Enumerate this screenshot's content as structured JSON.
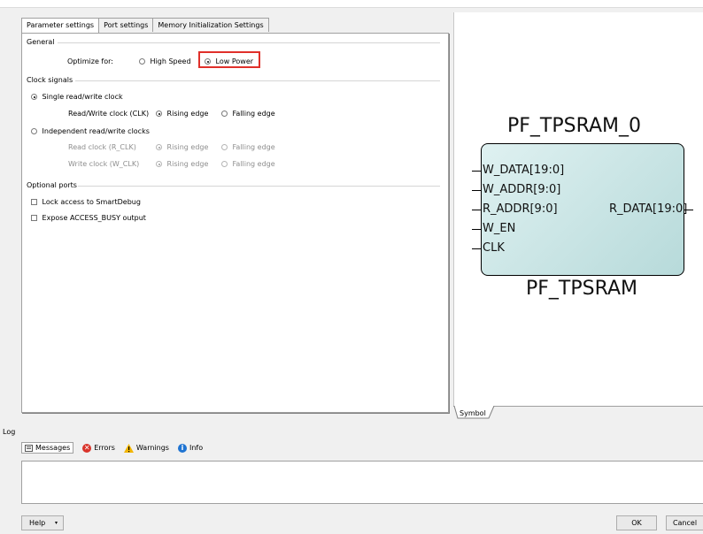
{
  "tabs": [
    "Parameter settings",
    "Port settings",
    "Memory Initialization Settings"
  ],
  "general": {
    "title": "General",
    "optimize_label": "Optimize for:",
    "high_speed": "High Speed",
    "low_power": "Low Power"
  },
  "clock": {
    "title": "Clock signals",
    "single": "Single read/write clock",
    "rw_clock": "Read/Write clock (CLK)",
    "rising": "Rising edge",
    "falling": "Falling edge",
    "independent": "Independent read/write clocks",
    "read_clock": "Read clock (R_CLK)",
    "write_clock": "Write clock (W_CLK)"
  },
  "optional": {
    "title": "Optional ports",
    "lock": "Lock access to SmartDebug",
    "expose": "Expose  ACCESS_BUSY output"
  },
  "symbol": {
    "instance": "PF_TPSRAM_0",
    "component": "PF_TPSRAM",
    "left_pins": [
      "W_DATA[19:0]",
      "W_ADDR[9:0]",
      "R_ADDR[9:0]",
      "W_EN",
      "CLK"
    ],
    "right_pins": [
      "R_DATA[19:0]"
    ],
    "tab": "Symbol"
  },
  "log": {
    "title": "Log",
    "messages": "Messages",
    "errors": "Errors",
    "warnings": "Warnings",
    "info": "Info"
  },
  "buttons": {
    "help": "Help",
    "ok": "OK",
    "cancel": "Cancel"
  },
  "colors": {
    "highlight": "#e0302a",
    "component_fill": "#c8e6e6",
    "error_icon": "#d9342b",
    "warning_icon": "#f2b500",
    "info_icon": "#1f74d2"
  },
  "icons": [
    "messages-icon",
    "error-icon",
    "warning-icon",
    "info-icon",
    "dropdown-arrow-icon"
  ]
}
